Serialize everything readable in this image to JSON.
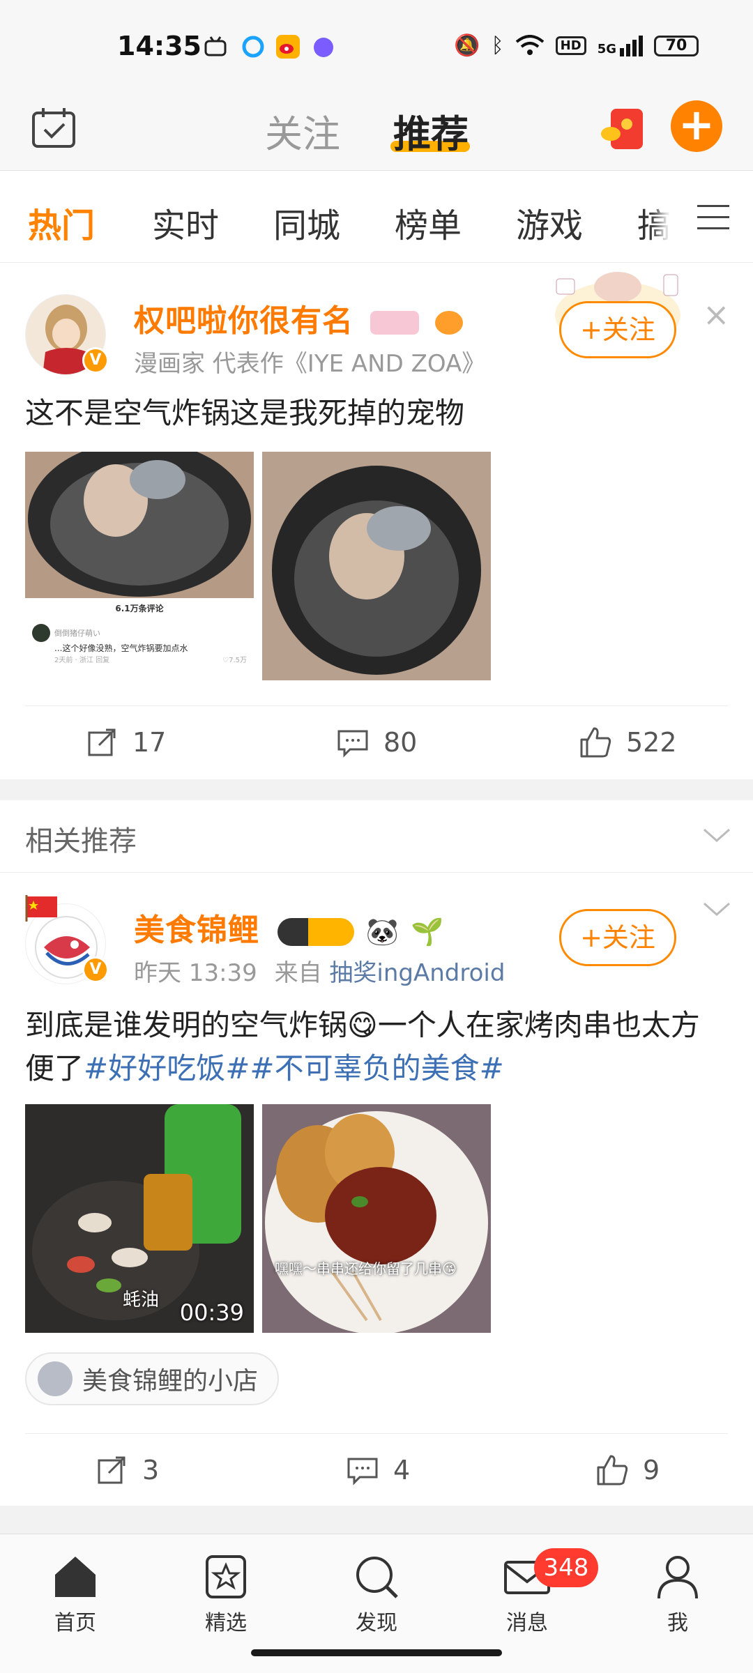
{
  "status_bar": {
    "time": "14:35",
    "network": "5G",
    "hd": "HD",
    "battery": "70"
  },
  "top_nav": {
    "follow_tab": "关注",
    "recommend_tab": "推荐",
    "accent": "#ff8200"
  },
  "channels": [
    "热门",
    "实时",
    "同城",
    "榜单",
    "游戏",
    "搞"
  ],
  "post1": {
    "user": "权吧啦你很有名",
    "meta": "漫画家 代表作《IYE AND ZOA》",
    "follow_label": "+关注",
    "close_label": "×",
    "text": "这不是空气炸锅这是我死掉的宠物",
    "embed_title": "6.1万条评论",
    "embed_user": "倒倒猪仔萌い",
    "embed_comment": "...这个好像没熟，空气炸锅要加点水",
    "embed_meta": "2天前 · 浙江  回复",
    "embed_likes": "♡7.5万",
    "repost": "17",
    "comment": "80",
    "like": "522"
  },
  "related": {
    "title": "相关推荐"
  },
  "post2": {
    "user": "美食锦鲤",
    "time": "昨天 13:39",
    "from": "来自",
    "source": "抽奖ingAndroid",
    "follow_label": "+关注",
    "text_part1": "到底是谁发明的空气炸锅",
    "emoji": "😋",
    "text_part2": "一个人在家烤肉串也太方便了",
    "tag1": "#好好吃饭#",
    "tag2": "#不可辜负的美食#",
    "video_caption": "蚝油",
    "video_duration": "00:39",
    "image_caption": "嘿嘿～串串还给你留了几串😘",
    "shop": "美食锦鲤的小店",
    "repost": "3",
    "comment": "4",
    "like": "9"
  },
  "bottom_nav": {
    "home": "首页",
    "featured": "精选",
    "discover": "发现",
    "messages": "消息",
    "me": "我",
    "message_badge": "348"
  }
}
